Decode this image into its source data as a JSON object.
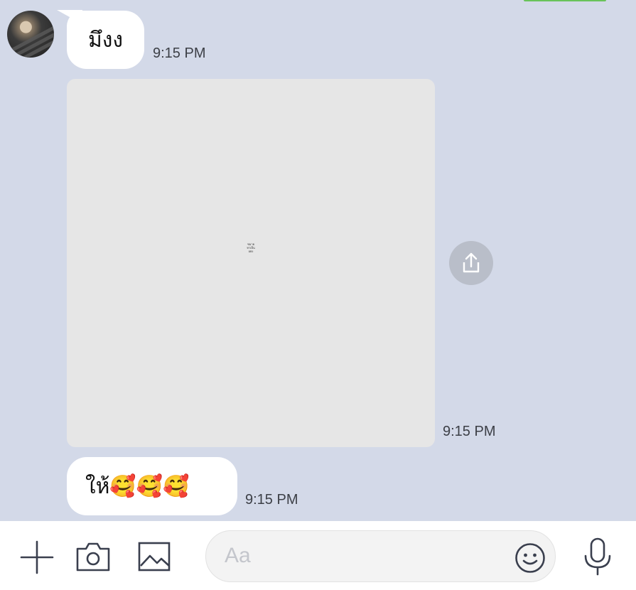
{
  "messages": [
    {
      "text": "มึงง",
      "time": "9:15 PM"
    },
    {
      "type": "image",
      "image_text": [
        "ชมาย",
        "หาเป็น",
        "อย่ง"
      ],
      "time": "9:15 PM"
    },
    {
      "text": "ให้🥰🥰🥰",
      "time": "9:15 PM"
    }
  ],
  "composer": {
    "placeholder": "Aa",
    "icons": [
      "plus-icon",
      "camera-icon",
      "image-icon",
      "emoji-icon",
      "microphone-icon"
    ]
  },
  "colors": {
    "chat_bg": "#d3d9e8",
    "bubble": "#ffffff",
    "accent_green": "#69c35a",
    "share_button": "#b9bec9",
    "icon": "#3a3f4e"
  }
}
